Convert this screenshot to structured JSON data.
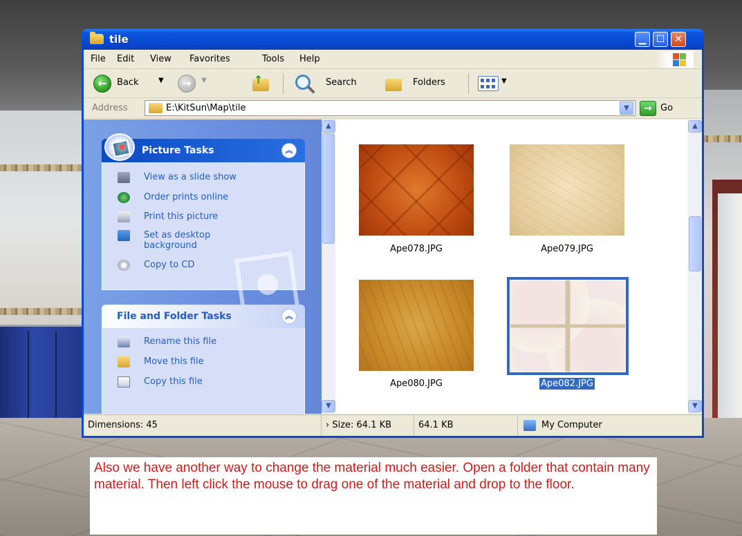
{
  "window": {
    "title": "tile",
    "title_icon": "folder-icon",
    "buttons": [
      "minimize",
      "maximize",
      "close"
    ]
  },
  "menubar": {
    "items": [
      "File",
      "Edit",
      "View",
      "Favorites",
      "Tools",
      "Help"
    ]
  },
  "toolbar": {
    "back_label": "Back",
    "search_label": "Search",
    "folders_label": "Folders"
  },
  "address": {
    "label": "Address",
    "path": "E:\\KitSun\\Map\\tile",
    "go_label": "Go"
  },
  "task_pane": {
    "picture_tasks": {
      "title": "Picture Tasks",
      "items": [
        {
          "label": "View as a slide show",
          "icon": "slideshow-icon"
        },
        {
          "label": "Order prints online",
          "icon": "globe-icon"
        },
        {
          "label": "Print this picture",
          "icon": "printer-icon"
        },
        {
          "label": "Set as desktop\nbackground",
          "icon": "desktop-icon"
        },
        {
          "label": "Copy to CD",
          "icon": "cd-icon"
        }
      ]
    },
    "file_folder_tasks": {
      "title": "File and Folder Tasks",
      "items": [
        {
          "label": "Rename this file",
          "icon": "rename-icon"
        },
        {
          "label": "Move this file",
          "icon": "move-icon"
        },
        {
          "label": "Copy this file",
          "icon": "copy-icon"
        }
      ]
    }
  },
  "files": [
    {
      "name": "Ape078.JPG",
      "selected": false
    },
    {
      "name": "Ape079.JPG",
      "selected": false
    },
    {
      "name": "Ape080.JPG",
      "selected": false
    },
    {
      "name": "Ape082.JPG",
      "selected": true
    }
  ],
  "statusbar": {
    "dimensions": "Dimensions: 45",
    "size": "› Size: 64.1 KB",
    "size2": "64.1 KB",
    "location": "My Computer"
  },
  "caption": {
    "text": "Also we have another way to change the material much easier. Open a folder that contain many material. Then left click the mouse to drag one of the material and drop to the floor."
  },
  "colors": {
    "title_bar": "#0a55e0",
    "selection": "#316ac5",
    "task_link": "#215dc6",
    "caption_text": "#d21a1a"
  }
}
